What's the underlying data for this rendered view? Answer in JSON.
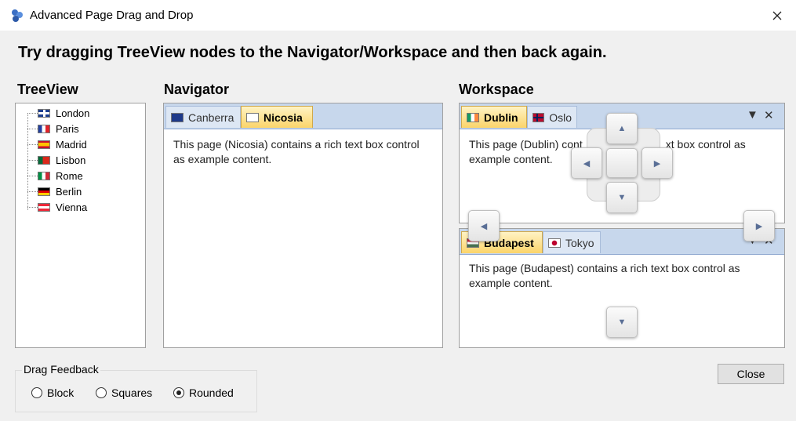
{
  "window": {
    "title": "Advanced Page Drag and Drop"
  },
  "heading": "Try dragging TreeView nodes to the Navigator/Workspace and then back again.",
  "treeview": {
    "label": "TreeView",
    "items": [
      {
        "label": "London",
        "flag": "uk-flag"
      },
      {
        "label": "Paris",
        "flag": "france-flag"
      },
      {
        "label": "Madrid",
        "flag": "spain-flag"
      },
      {
        "label": "Lisbon",
        "flag": "portugal-flag"
      },
      {
        "label": "Rome",
        "flag": "italy-flag"
      },
      {
        "label": "Berlin",
        "flag": "germany-flag"
      },
      {
        "label": "Vienna",
        "flag": "austria-flag"
      }
    ]
  },
  "navigator": {
    "label": "Navigator",
    "tabs": [
      {
        "label": "Canberra",
        "active": false
      },
      {
        "label": "Nicosia",
        "active": true
      }
    ],
    "content": "This page (Nicosia) contains a rich text box control as example content."
  },
  "workspace": {
    "label": "Workspace",
    "top": {
      "tabs": [
        {
          "label": "Dublin",
          "active": true
        },
        {
          "label": "Oslo",
          "active": false
        }
      ],
      "content_line1": "This page (Dublin) cont",
      "content_line1_end": "xt box control as",
      "content_line2": "example content."
    },
    "bottom": {
      "tabs": [
        {
          "label": "Budapest",
          "active": true
        },
        {
          "label": "Tokyo",
          "active": false
        }
      ],
      "content": "This page (Budapest) contains a rich text box control as example content."
    }
  },
  "drag_feedback": {
    "label": "Drag Feedback",
    "options": [
      {
        "label": "Block",
        "selected": false
      },
      {
        "label": "Squares",
        "selected": false
      },
      {
        "label": "Rounded",
        "selected": true
      }
    ]
  },
  "close_label": "Close"
}
